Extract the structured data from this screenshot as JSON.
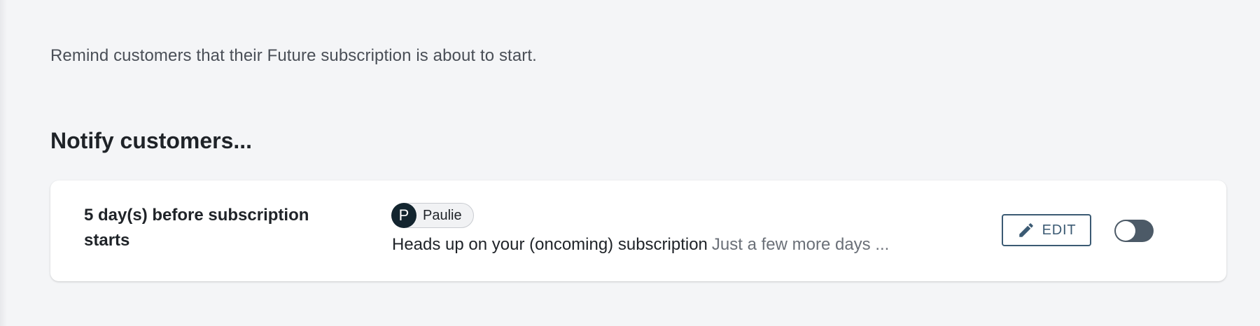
{
  "intro_text": "Remind customers that their Future subscription is about to start.",
  "section_title": "Notify customers...",
  "notification": {
    "timing": "5 day(s) before subscription starts",
    "sender": {
      "initial": "P",
      "name": "Paulie"
    },
    "subject": "Heads up on your (oncoming) subscription",
    "preview": "Just a few more days ...",
    "edit_label": "EDIT",
    "edit_icon": "pencil-icon",
    "enabled": false
  },
  "colors": {
    "background": "#f4f5f7",
    "accent": "#3b5a73",
    "toggle_off": "#4c5a67",
    "avatar": "#13252f"
  }
}
